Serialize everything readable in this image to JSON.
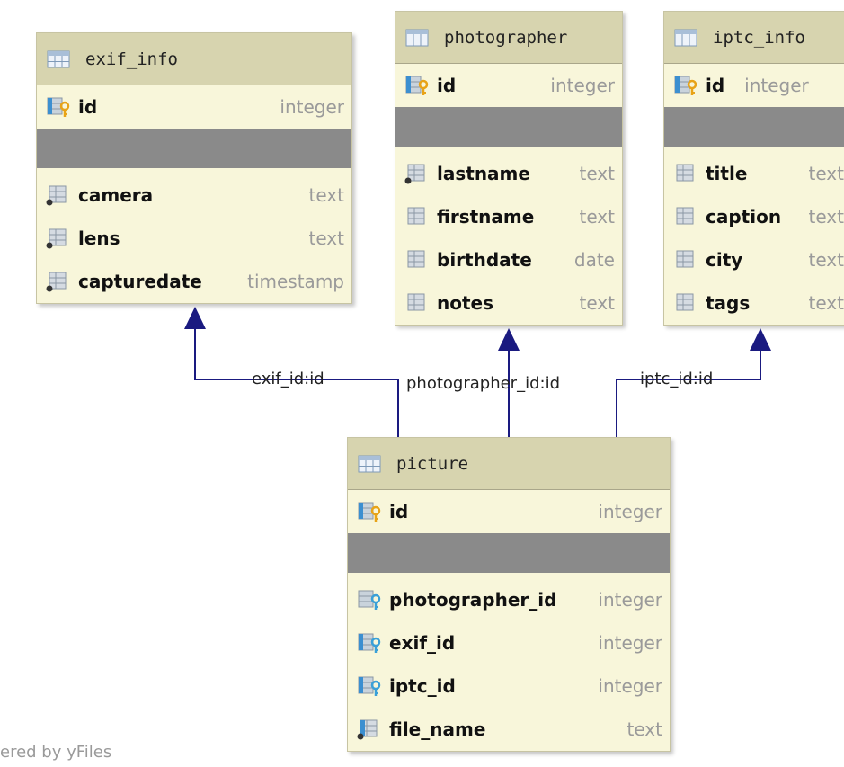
{
  "tables": {
    "exif_info": {
      "name": "exif_info",
      "pk": {
        "name": "id",
        "type": "integer"
      },
      "columns": [
        {
          "name": "camera",
          "type": "text"
        },
        {
          "name": "lens",
          "type": "text"
        },
        {
          "name": "capturedate",
          "type": "timestamp"
        }
      ]
    },
    "photographer": {
      "name": "photographer",
      "pk": {
        "name": "id",
        "type": "integer"
      },
      "columns": [
        {
          "name": "lastname",
          "type": "text"
        },
        {
          "name": "firstname",
          "type": "text"
        },
        {
          "name": "birthdate",
          "type": "date"
        },
        {
          "name": "notes",
          "type": "text"
        }
      ]
    },
    "iptc_info": {
      "name": "iptc_info",
      "pk": {
        "name": "id",
        "type": "integer"
      },
      "columns": [
        {
          "name": "title",
          "type": "text"
        },
        {
          "name": "caption",
          "type": "text"
        },
        {
          "name": "city",
          "type": "text"
        },
        {
          "name": "tags",
          "type": "text"
        }
      ]
    },
    "picture": {
      "name": "picture",
      "pk": {
        "name": "id",
        "type": "integer"
      },
      "fks": [
        {
          "name": "photographer_id",
          "type": "integer"
        },
        {
          "name": "exif_id",
          "type": "integer"
        },
        {
          "name": "iptc_id",
          "type": "integer"
        }
      ],
      "columns": [
        {
          "name": "file_name",
          "type": "text"
        }
      ]
    }
  },
  "relations": {
    "exif": "exif_id:id",
    "photographer": "photographer_id:id",
    "iptc": "iptc_id:id"
  },
  "watermark": "ered by yFiles",
  "colors": {
    "header": "#d7d4af",
    "body": "#f8f6da",
    "separator": "#8a8a8a",
    "edge": "#1a1a80",
    "pk_key": "#e8a317",
    "fk_key": "#3aa0d8"
  },
  "icons": {
    "table": "table-icon",
    "primary_key": "primary-key-icon",
    "foreign_key": "foreign-key-icon",
    "column": "column-icon"
  }
}
